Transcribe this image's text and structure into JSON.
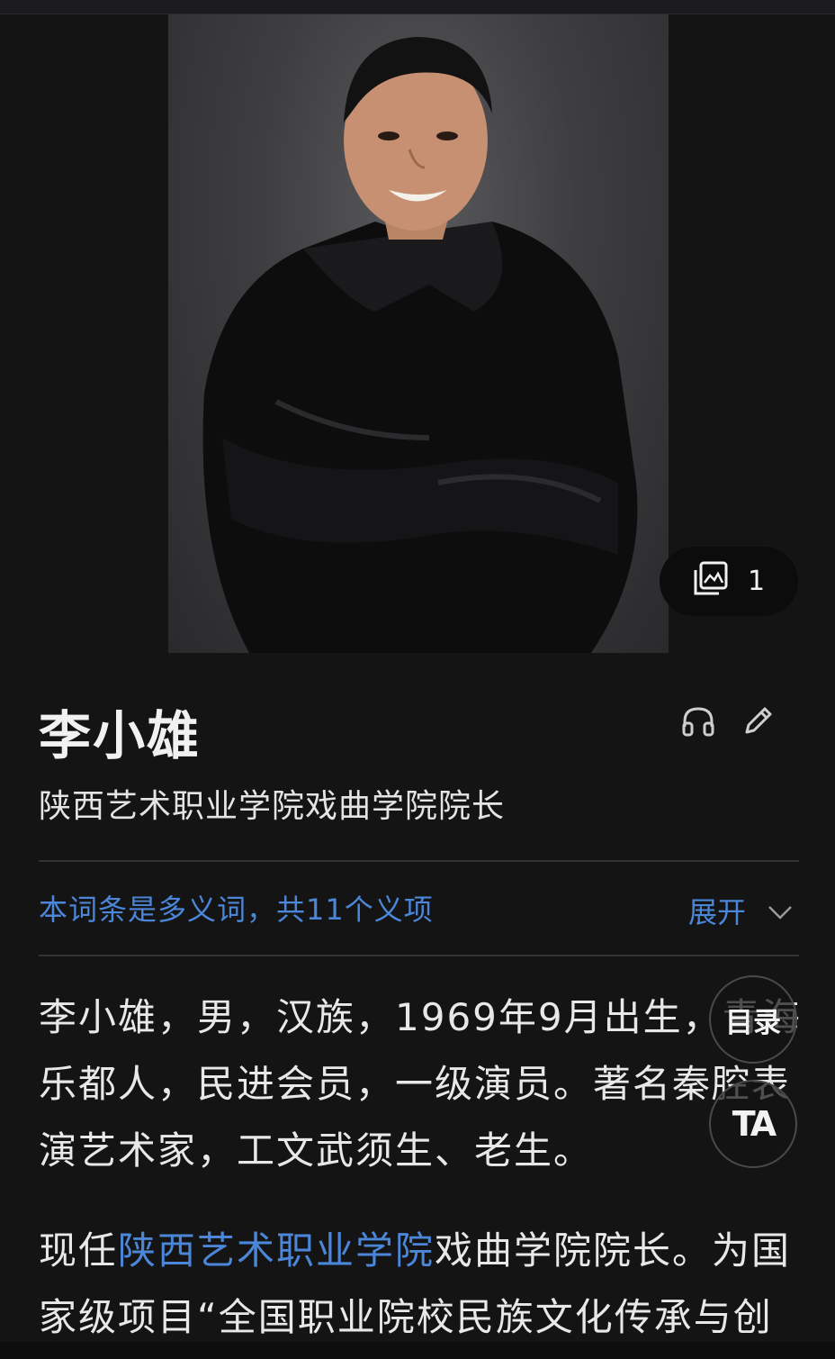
{
  "gallery": {
    "count": "1",
    "icon": "image-gallery-icon"
  },
  "entry": {
    "name": "李小雄",
    "subtitle": "陕西艺术职业学院戏曲学院院长"
  },
  "actions": {
    "listen_icon": "headphones-icon",
    "edit_icon": "pencil-icon"
  },
  "polysemy": {
    "text": "本词条是多义词，共11个义项",
    "expand_label": "展开",
    "expand_icon": "chevron-down-icon"
  },
  "intro": {
    "line1": "李小雄，男，汉族，1969年9月出生，青海",
    "line2": "乐都人，民进会员，一级演员。著名秦腔表",
    "line3": "演艺术家，工文武须生、老生。"
  },
  "para2": {
    "prefix": "现任",
    "link": "陕西艺术职业学院",
    "rest1": "戏曲学院院长。为国",
    "line2": "家级项目“全国职业院校民族文化传承与创"
  },
  "floating": {
    "toc_label": "目录",
    "ta_label": "TA"
  },
  "colors": {
    "background": "#141414",
    "link": "#4b86d8",
    "text": "#e8e8e8"
  }
}
